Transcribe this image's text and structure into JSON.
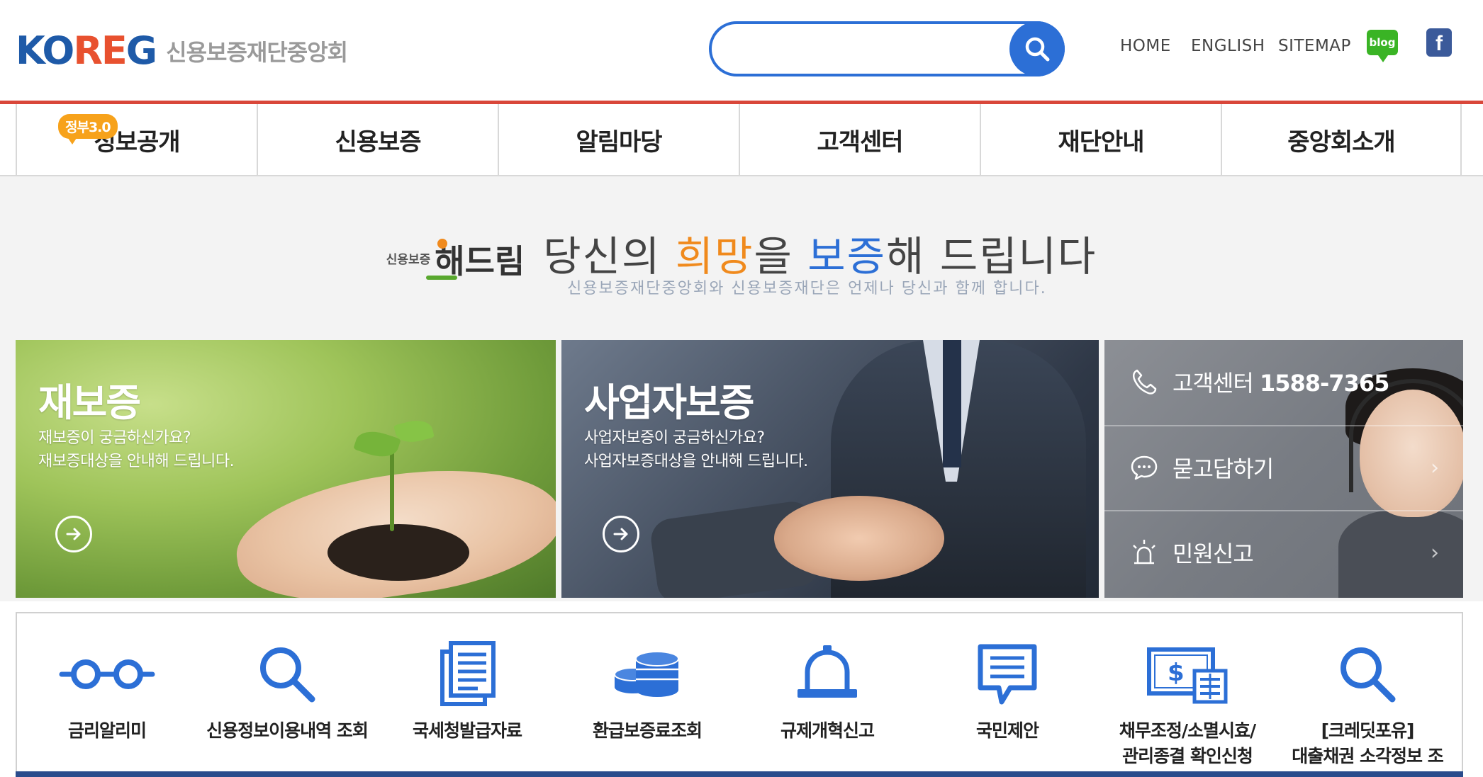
{
  "header": {
    "logo_text_ko": "KO",
    "logo_text_re": "RE",
    "logo_text_g": "G",
    "org_name": "신용보증재단중앙회",
    "search": {
      "placeholder": "",
      "value": ""
    },
    "util_links": [
      "HOME",
      "ENGLISH",
      "SITEMAP"
    ],
    "blog_label": "blog",
    "facebook_label": "f"
  },
  "nav": {
    "gov_badge": "정부3.0",
    "items": [
      "정보공개",
      "신용보증",
      "알림마당",
      "고객센터",
      "재단안내",
      "중앙회소개"
    ]
  },
  "slogan": {
    "brand_small": "신용보증",
    "brand": "해드림",
    "main_1": "당신의 ",
    "main_highlight_1": "희망",
    "main_2": "을 ",
    "main_highlight_2": "보증",
    "main_3": "해 드립니다",
    "sub": "신용보증재단중앙회와 신용보증재단은 언제나 당신과 함께 합니다."
  },
  "cards": {
    "reguarantee": {
      "title": "재보증",
      "line1": "재보증이 궁금하신가요?",
      "line2": "재보증대상을 안내해 드립니다."
    },
    "business": {
      "title": "사업자보증",
      "line1": "사업자보증이 궁금하신가요?",
      "line2": "사업자보증대상을 안내해 드립니다."
    },
    "service": {
      "call_label": "고객센터 ",
      "call_number": "1588-7365",
      "qna": "묻고답하기",
      "complaint": "민원신고"
    }
  },
  "quick_links": [
    {
      "icon": "glasses-icon",
      "label1": "금리알리미",
      "label2": ""
    },
    {
      "icon": "search-icon",
      "label1": "신용정보이용내역 조회",
      "label2": ""
    },
    {
      "icon": "document-icon",
      "label1": "국세청발급자료",
      "label2": ""
    },
    {
      "icon": "coins-icon",
      "label1": "환급보증료조회",
      "label2": ""
    },
    {
      "icon": "alarm-bell-icon",
      "label1": "규제개혁신고",
      "label2": ""
    },
    {
      "icon": "speech-bubble-icon",
      "label1": "국민제안",
      "label2": ""
    },
    {
      "icon": "bill-icon",
      "label1": "채무조정/소멸시효/",
      "label2": "관리종결 확인신청"
    },
    {
      "icon": "search-icon",
      "label1": "[크레딧포유]",
      "label2": "대출채권 소각정보 조"
    }
  ],
  "colors": {
    "brand_blue": "#2c6fd6",
    "brand_red": "#d9473a",
    "accent_orange": "#f08a1d",
    "nav_bottom": "#2a4c8c"
  }
}
